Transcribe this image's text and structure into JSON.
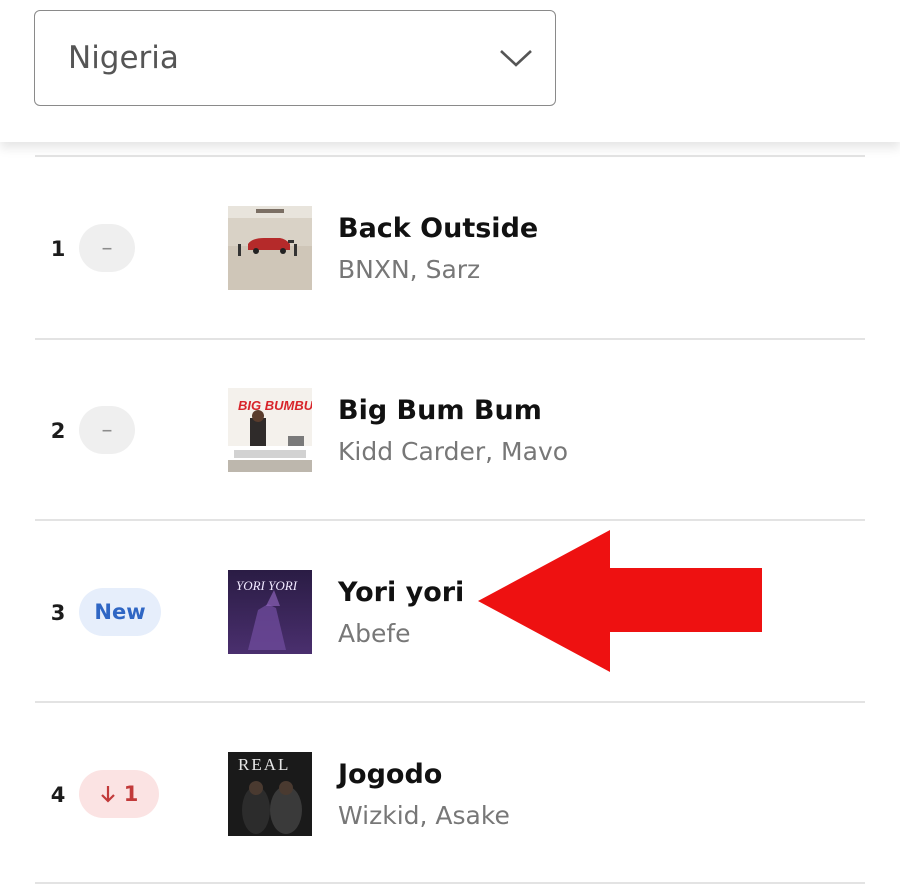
{
  "country_select": {
    "value": "Nigeria",
    "icon": "chevron-down-icon"
  },
  "chart": {
    "rows": [
      {
        "rank": "1",
        "badge": "–",
        "badge_type": "same",
        "title": "Back Outside",
        "artists": "BNXN, Sarz"
      },
      {
        "rank": "2",
        "badge": "–",
        "badge_type": "same",
        "title": "Big Bum Bum",
        "artists": "Kidd Carder, Mavo"
      },
      {
        "rank": "3",
        "badge": "New",
        "badge_type": "new",
        "title": "Yori yori",
        "artists": "Abefe"
      },
      {
        "rank": "4",
        "badge": "1",
        "badge_type": "down",
        "badge_icon": "arrow-down-icon",
        "title": "Jogodo",
        "artists": "Wizkid, Asake"
      }
    ]
  },
  "artwork_text": {
    "big_bum_bum": "BIG BUMBUM",
    "yori_yori": "YORI YORI",
    "jogodo": "REAL"
  },
  "colors": {
    "highlight_arrow": "#ee1111",
    "new_badge": "#2f66c4",
    "down_badge": "#c23a3a"
  }
}
